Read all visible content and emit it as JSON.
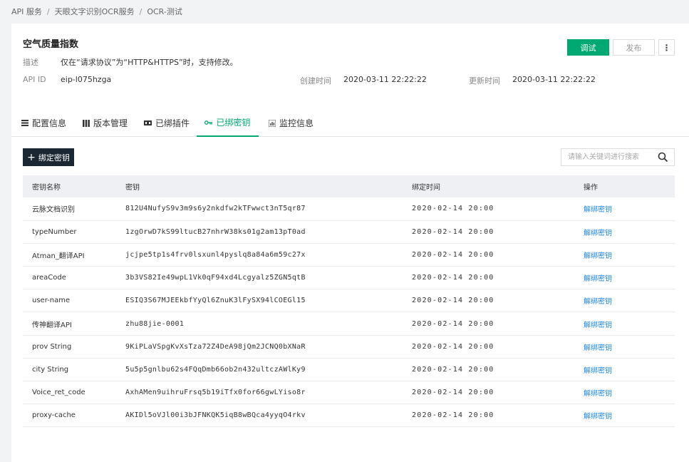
{
  "breadcrumb": [
    "API 服务",
    "天眼文字识别OCR服务",
    "OCR-测试"
  ],
  "api": {
    "title": "空气质量指数",
    "desc_label": "描述",
    "desc_value": "仅在“请求协议”为“HTTP&HTTPS”时，支持修改。",
    "id_label": "API ID",
    "id_value": "eip-l075hzga",
    "created_label": "创建时间",
    "created_value": "2020-03-11 22:22:22",
    "updated_label": "更新时间",
    "updated_value": "2020-03-11 22:22:22"
  },
  "actions": {
    "debug": "调试",
    "publish": "发布",
    "more": "⋮"
  },
  "tabs": [
    {
      "label": "配置信息",
      "icon": "list-icon"
    },
    {
      "label": "版本管理",
      "icon": "columns-icon"
    },
    {
      "label": "已绑插件",
      "icon": "plugin-icon"
    },
    {
      "label": "已绑密钥",
      "icon": "key-icon"
    },
    {
      "label": "监控信息",
      "icon": "chart-icon"
    }
  ],
  "active_tab": 3,
  "toolbar": {
    "bind_label": "绑定密钥",
    "search_placeholder": "请输入关键词进行搜索"
  },
  "table": {
    "columns": [
      "密钥名称",
      "密钥",
      "绑定时间",
      "操作"
    ],
    "rows": [
      {
        "name": "云脉文档识别",
        "key": "812U4NufyS9v3m9s6y2nkdfw2kTFwwct3nT5qr87",
        "time": "2020-02-14 20:00",
        "action": "解绑密钥"
      },
      {
        "name": "typeNumber",
        "key": "1zgOrwD7kS99ltucB27nhrW38ks01g2am13pT0ad",
        "time": "2020-02-14 20:00",
        "action": "解绑密钥"
      },
      {
        "name": "Atman_翻译API",
        "key": "jcjpe5tp1s4frv0lsxunl4pyslq8a84a6m59c27x",
        "time": "2020-02-14 20:00",
        "action": "解绑密钥"
      },
      {
        "name": "areaCode",
        "key": "3b3VS82Ie49wpL1Vk0qF94xd4Lcgyalz5ZGN5qtB",
        "time": "2020-02-14 20:00",
        "action": "解绑密钥"
      },
      {
        "name": "user-name",
        "key": "ESIQ3S67MJEEkbfYyQl6ZnuK3lFySX94lCOEGl15",
        "time": "2020-02-14 20:00",
        "action": "解绑密钥"
      },
      {
        "name": "传神翻译API",
        "key": "zhu88jie-0001",
        "time": "2020-02-14 20:00",
        "action": "解绑密钥"
      },
      {
        "name": "prov String",
        "key": "9KiPLaVSpgKvXsTza72Z4DeA98jQm2JCNQ0bXNaR",
        "time": "2020-02-14 20:00",
        "action": "解绑密钥"
      },
      {
        "name": "city String",
        "key": "5u5p5gnlbu62s4FQqDmb66ob2n432ultczAWlKy9",
        "time": "2020-02-14 20:00",
        "action": "解绑密钥"
      },
      {
        "name": "Voice_ret_code",
        "key": "AxhAMen9uihruFrsq5b19iTfx0for66gwLYiso8r",
        "time": "2020-02-14 20:00",
        "action": "解绑密钥"
      },
      {
        "name": "proxy-cache",
        "key": "AKIDl5oVJl00i3bJFNKQK5iqB8wBQca4yyqO4rkv",
        "time": "2020-02-14 20:00",
        "action": "解绑密钥"
      }
    ]
  },
  "colors": {
    "accent": "#00a971",
    "dark_button": "#1b2733",
    "link": "#1e88e5"
  }
}
